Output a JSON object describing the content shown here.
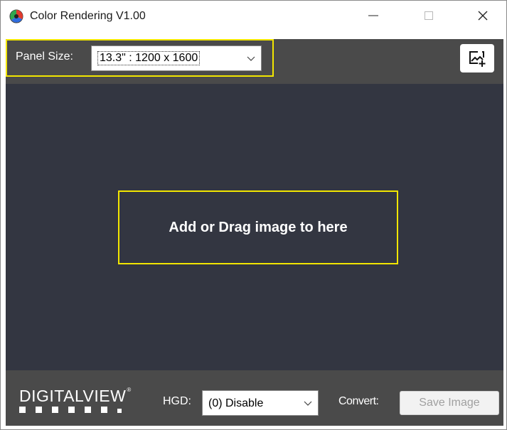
{
  "window": {
    "title": "Color Rendering V1.00",
    "controls": {
      "minimize": "minimize-icon",
      "maximize": "maximize-icon",
      "close": "close-icon"
    }
  },
  "toolbar": {
    "panel_size_label": "Panel Size:",
    "panel_size_value": "13.3\" : 1200 x 1600",
    "add_image_icon": "add-image-icon"
  },
  "drop_area": {
    "text": "Add or Drag image to here"
  },
  "bottom": {
    "logo_text": "DIGITALVIEW",
    "logo_mark": "®",
    "hgd_label": "HGD:",
    "hgd_value": "(0) Disable",
    "convert_label": "Convert:",
    "save_label": "Save Image"
  },
  "colors": {
    "toolbar_bg": "#4a4a4a",
    "drop_bg": "#333641",
    "highlight": "#f2e600"
  }
}
